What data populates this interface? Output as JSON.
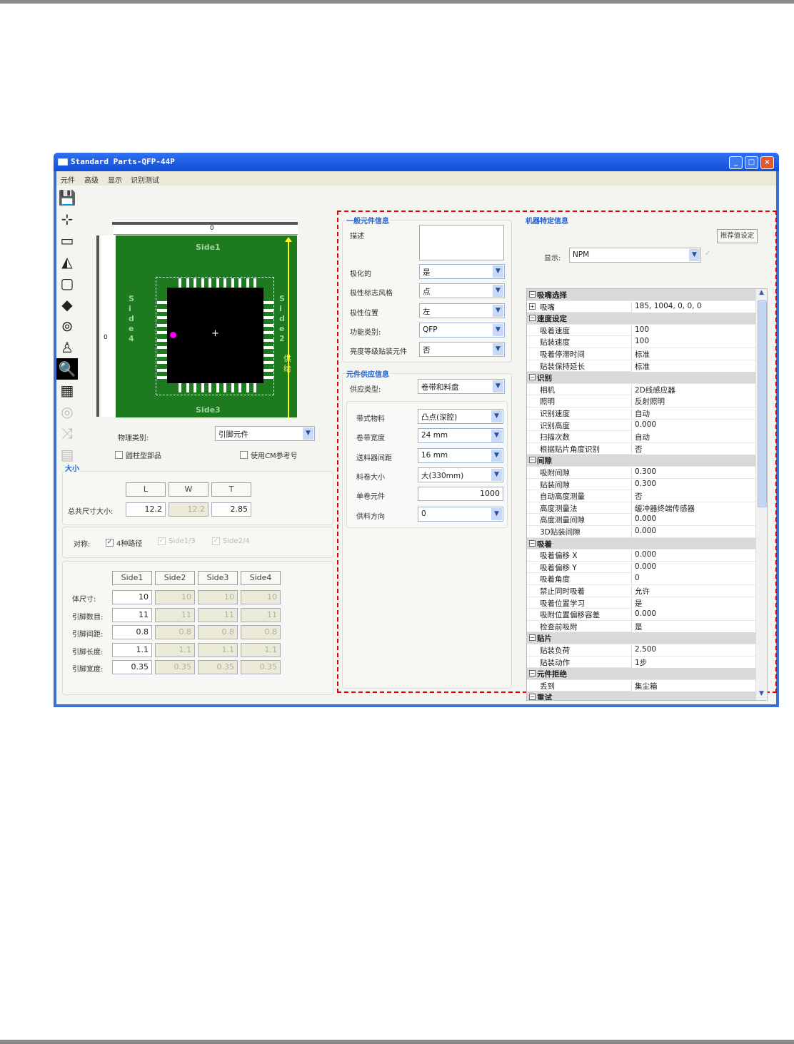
{
  "window": {
    "title": "Standard Parts-QFP-44P",
    "minimize": "_",
    "maximize": "□",
    "close": "×"
  },
  "menu": [
    "元件",
    "高级",
    "显示",
    "识别测试"
  ],
  "toolbar_icons": [
    "save-icon",
    "nozzle-icon",
    "tray-icon",
    "lighting-icon",
    "outline-icon",
    "polarity-icon",
    "inspection-icon",
    "marker-icon",
    "zoom-icon",
    "image-icon",
    "nozzle-layout-icon",
    "shuffle-icon",
    "disabled-doc-icon"
  ],
  "preview": {
    "side1": "Side1",
    "side2": "Side2",
    "side3": "Side3",
    "side4": "Side4",
    "feed": "供给",
    "ruler_top": "0",
    "ruler_left": "0",
    "pad_color": "#1e7a1e",
    "polarity_color": "#ff00ff",
    "feed_color": "#ffff00"
  },
  "physical": {
    "label": "物理类别:",
    "value": "引脚元件",
    "cylinder": "圆柱型部品",
    "use_cm": "使用CM参考号"
  },
  "size": {
    "title": "大小",
    "headers": [
      "L",
      "W",
      "T"
    ],
    "row_label": "总共尺寸大小:",
    "values": [
      "12.2",
      "12.2",
      "2.85"
    ]
  },
  "symmetry": {
    "label": "对称:",
    "options": [
      {
        "label": "4种路径",
        "checked": true,
        "enabled": true
      },
      {
        "label": "Side1/3",
        "checked": true,
        "enabled": false
      },
      {
        "label": "Side2/4",
        "checked": true,
        "enabled": false
      }
    ]
  },
  "sides": {
    "headers": [
      "Side1",
      "Side2",
      "Side3",
      "Side4"
    ],
    "rows": [
      {
        "label": "体尺寸:",
        "values": [
          "10",
          "10",
          "10",
          "10"
        ]
      },
      {
        "label": "引脚数目:",
        "values": [
          "11",
          "11",
          "11",
          "11"
        ]
      },
      {
        "label": "引脚间距:",
        "values": [
          "0.8",
          "0.8",
          "0.8",
          "0.8"
        ]
      },
      {
        "label": "引脚长度:",
        "values": [
          "1.1",
          "1.1",
          "1.1",
          "1.1"
        ]
      },
      {
        "label": "引脚宽度:",
        "values": [
          "0.35",
          "0.35",
          "0.35",
          "0.35"
        ]
      }
    ]
  },
  "general": {
    "title": "一般元件信息",
    "desc_label": "描述",
    "desc_value": "",
    "fields": [
      {
        "label": "极化的",
        "value": "是"
      },
      {
        "label": "极性标志风格",
        "value": "点"
      },
      {
        "label": "极性位置",
        "value": "左"
      },
      {
        "label": "功能类别:",
        "value": "QFP"
      },
      {
        "label": "亮度等级贴装元件",
        "value": "否"
      }
    ]
  },
  "supply": {
    "title": "元件供应信息",
    "type_label": "供应类型:",
    "type_value": "卷带和料盘",
    "fields": [
      {
        "label": "带式物料",
        "value": "凸点(深腔)",
        "kind": "combo"
      },
      {
        "label": "卷带宽度",
        "value": "24 mm",
        "kind": "combo"
      },
      {
        "label": "送料器间距",
        "value": "16 mm",
        "kind": "combo"
      },
      {
        "label": "料卷大小",
        "value": "大(330mm)",
        "kind": "combo"
      },
      {
        "label": "单卷元件",
        "value": "1000",
        "kind": "text"
      },
      {
        "label": "供料方向",
        "value": "0",
        "kind": "combo"
      }
    ]
  },
  "machine": {
    "title": "机器特定信息",
    "recommend_button": "推荐值设定",
    "display_label": "显示:",
    "display_value": "NPM",
    "props": [
      {
        "cat": "吸嘴选择"
      },
      {
        "name": "吸嘴",
        "value": "185, 1004, 0, 0, 0",
        "expand": true
      },
      {
        "cat": "速度设定"
      },
      {
        "name": "吸着速度",
        "value": "100"
      },
      {
        "name": "贴装速度",
        "value": "100"
      },
      {
        "name": "吸着停滞时间",
        "value": "标准"
      },
      {
        "name": "贴装保持延长",
        "value": "标准"
      },
      {
        "cat": "识别"
      },
      {
        "name": "相机",
        "value": "2D线感应器"
      },
      {
        "name": "照明",
        "value": "反射照明"
      },
      {
        "name": "识别速度",
        "value": "自动"
      },
      {
        "name": "识别高度",
        "value": "0.000"
      },
      {
        "name": "扫描次数",
        "value": "自动"
      },
      {
        "name": "根据贴片角度识别",
        "value": "否"
      },
      {
        "cat": "间隙"
      },
      {
        "name": "吸附间隙",
        "value": "0.300"
      },
      {
        "name": "贴装间隙",
        "value": "0.300"
      },
      {
        "name": "自动高度测量",
        "value": "否"
      },
      {
        "name": "高度测量法",
        "value": "缓冲器终端传感器"
      },
      {
        "name": "高度测量间隙",
        "value": "0.000"
      },
      {
        "name": "3D贴装间隙",
        "value": "0.000"
      },
      {
        "cat": "吸着"
      },
      {
        "name": "吸着偏移 X",
        "value": "0.000"
      },
      {
        "name": "吸着偏移 Y",
        "value": "0.000"
      },
      {
        "name": "吸着角度",
        "value": "0"
      },
      {
        "name": "禁止同时吸着",
        "value": "允许"
      },
      {
        "name": "吸着位置学习",
        "value": "是"
      },
      {
        "name": "吸附位置偏移容差",
        "value": "0.000"
      },
      {
        "name": "检查前吸附",
        "value": "是"
      },
      {
        "cat": "贴片"
      },
      {
        "name": "贴装负荷",
        "value": "2.500"
      },
      {
        "name": "贴装动作",
        "value": "1步"
      },
      {
        "cat": "元件拒绝"
      },
      {
        "name": "丢到",
        "value": "集尘箱"
      },
      {
        "cat": "重试"
      }
    ]
  }
}
